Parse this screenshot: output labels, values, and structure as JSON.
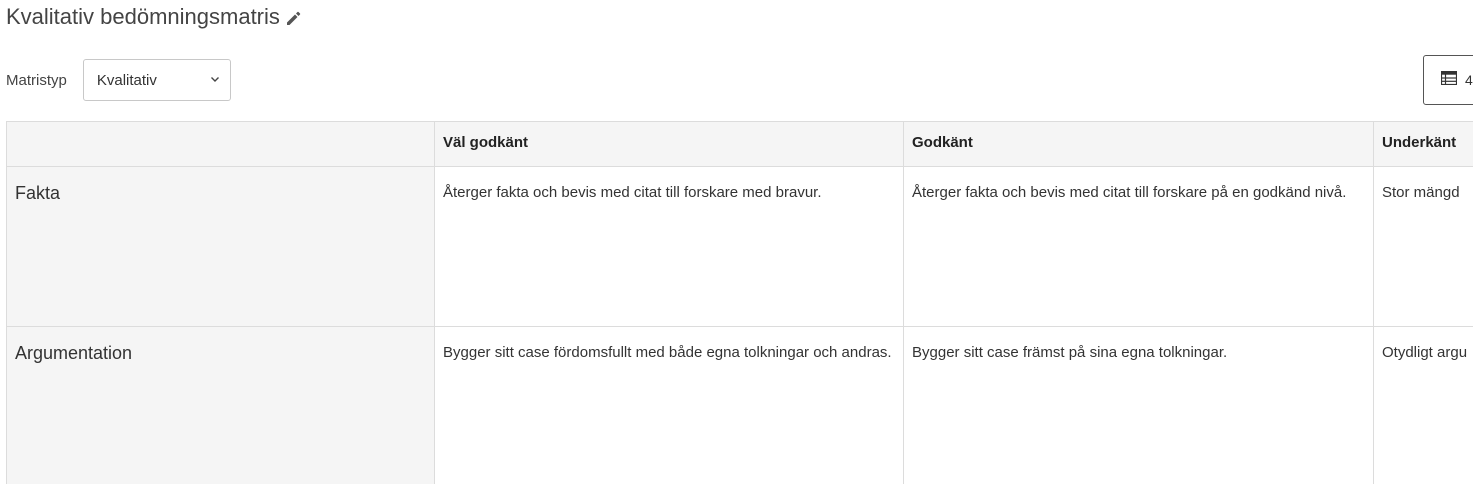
{
  "header": {
    "title": "Kvalitativ bedömningsmatris",
    "edit_icon": "pencil-icon"
  },
  "toolbar": {
    "matrix_type_label": "Matristyp",
    "matrix_type_value": "Kvalitativ",
    "view_button_label": "4",
    "view_button_icon": "table-list-icon"
  },
  "matrix": {
    "columns": [
      "",
      "Väl godkänt",
      "Godkänt",
      "Underkänt"
    ],
    "rows": [
      {
        "criterion": "Fakta",
        "cells": [
          "Återger fakta och bevis med citat till forskare med bravur.",
          "Återger fakta och bevis med citat till forskare på en godkänd nivå.",
          "Stor mängd"
        ]
      },
      {
        "criterion": "Argumentation",
        "cells": [
          "Bygger sitt case fördomsfullt med både egna tolkningar och andras.",
          "Bygger sitt case främst på sina egna tolkningar.",
          "Otydligt argu"
        ]
      }
    ]
  },
  "colors": {
    "border": "#dcdcdc",
    "header_bg": "#f5f5f5",
    "text": "#333333"
  }
}
